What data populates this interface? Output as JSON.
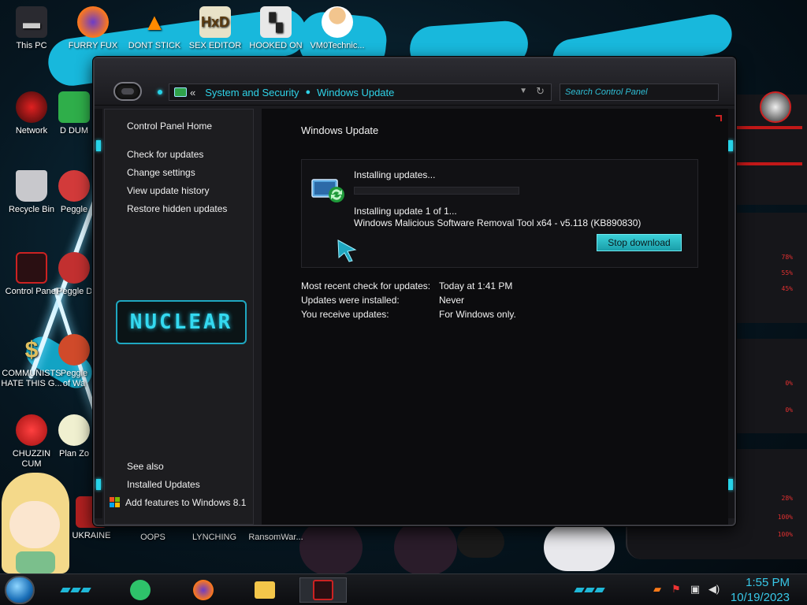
{
  "desktop": {
    "icons": [
      {
        "label": "This PC"
      },
      {
        "label": "FURRY FUX"
      },
      {
        "label": "DONT STICK"
      },
      {
        "label": "SEX EDITOR"
      },
      {
        "label": "HOOKED ON"
      },
      {
        "label": "VM0Technic..."
      },
      {
        "label": "Network"
      },
      {
        "label": "D DUM"
      },
      {
        "label": "Recycle Bin"
      },
      {
        "label": "Peggle"
      },
      {
        "label": "Control Panel"
      },
      {
        "label": "Peggle De"
      },
      {
        "label": "COMMUNISTS HATE THIS G..."
      },
      {
        "label": "Peggle of Wa"
      },
      {
        "label": "CHUZZIN CUM"
      },
      {
        "label": "Plan Zo"
      },
      {
        "label": "UKRAINE"
      },
      {
        "label": "OOPS"
      },
      {
        "label": "LYNCHING"
      },
      {
        "label": "RansomWar..."
      }
    ],
    "wallpaper_readouts": [
      "78%",
      "55%",
      "45%",
      "0%",
      "0%",
      "28%",
      "100%",
      "100%"
    ]
  },
  "window": {
    "breadcrumb": {
      "back": "«",
      "items": [
        "System and Security",
        "Windows Update"
      ]
    },
    "search_placeholder": "Search Control Panel",
    "nav": {
      "home": "Control Panel Home",
      "links": [
        "Check for updates",
        "Change settings",
        "View update history",
        "Restore hidden updates"
      ],
      "logo_text": "NUCLEAR",
      "see_also_heading": "See also",
      "see_also": [
        "Installed Updates",
        "Add features to Windows 8.1"
      ]
    },
    "content": {
      "heading": "Windows Update",
      "installing": "Installing updates...",
      "progress": 0.0,
      "status_line1": "Installing update 1 of 1...",
      "status_line2": "Windows Malicious Software Removal Tool x64 - v5.118 (KB890830)",
      "stop_button": "Stop download",
      "info": [
        {
          "label": "Most recent check for updates:",
          "value": "Today at 1:41 PM"
        },
        {
          "label": "Updates were installed:",
          "value": "Never"
        },
        {
          "label": "You receive updates:",
          "value": "For Windows only."
        }
      ]
    }
  },
  "taskbar": {
    "time": "1:55 PM",
    "date": "10/19/2023"
  },
  "colors": {
    "accent": "#2fd3e8",
    "button": "#27b8c4",
    "window_bg": "#1b1b1f",
    "content_bg": "#0c0c0e"
  }
}
